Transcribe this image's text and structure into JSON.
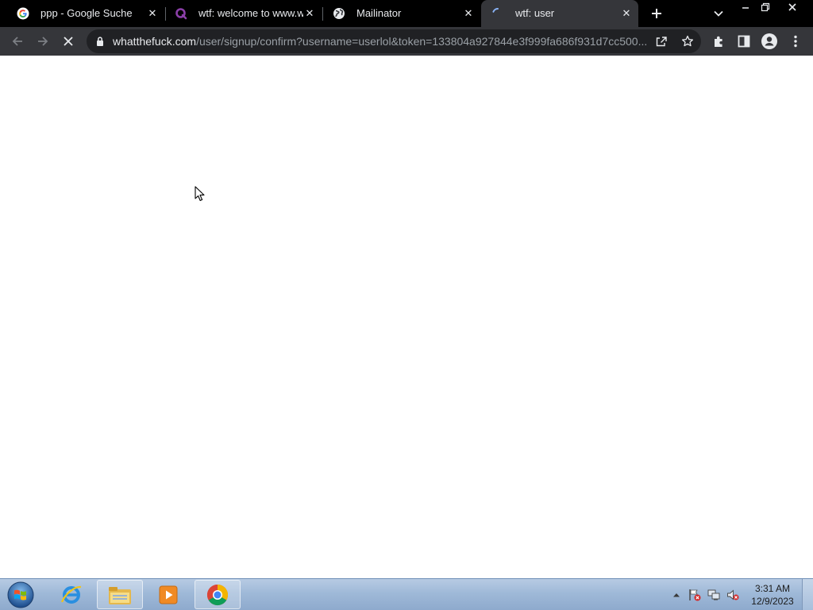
{
  "browser": {
    "tabs": [
      {
        "title": "ppp - Google Suche",
        "icon": "google-icon",
        "active": false
      },
      {
        "title": "wtf: welcome to www.wha",
        "icon": "q-icon",
        "active": false
      },
      {
        "title": "Mailinator",
        "icon": "globe-icon",
        "active": false
      },
      {
        "title": "wtf: user",
        "icon": "loading-spinner-icon",
        "active": true
      }
    ],
    "address_bar": {
      "host": "whatthefuck.com",
      "path": "/user/signup/confirm?username=userlol&token=133804a927844e3f999fa686f931d7cc500..."
    }
  },
  "taskbar": {
    "clock_time": "3:31 AM",
    "clock_date": "12/9/2023"
  },
  "colors": {
    "tabstrip_bg": "#000000",
    "toolbar_bg": "#35363a",
    "omnibox_bg": "#202124",
    "text_light": "#e8eaed",
    "text_dim": "#9aa0a6",
    "spinner_blue": "#8ab4f8"
  }
}
